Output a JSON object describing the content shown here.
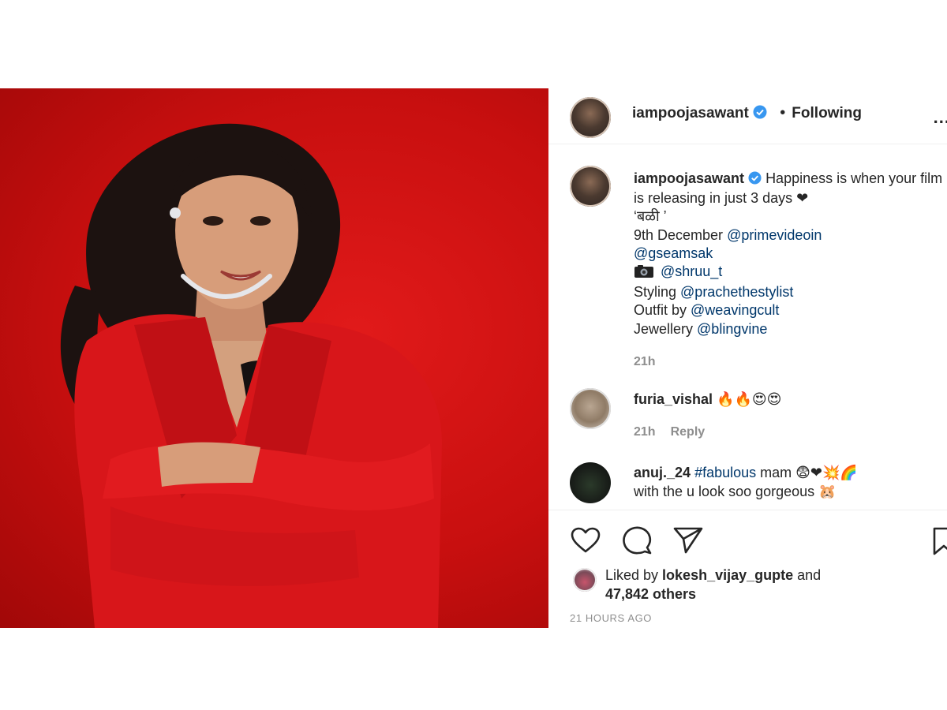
{
  "post": {
    "photo_alt": "",
    "header": {
      "username": "iampoojasawant",
      "separator": "•",
      "follow_status": "Following",
      "more_label": "..."
    },
    "caption": {
      "username": "iampoojasawant",
      "line1": "Happiness is when your film is releasing in just 3 days ❤",
      "line2": "‘बळी ’",
      "line3_prefix": "9th December ",
      "line3_mention": "@primevideoin",
      "line4_mention": "@gseamsak",
      "line5_icon": "camera-icon",
      "line5_mention": "@shruu_t",
      "line6_prefix": "Styling ",
      "line6_mention": "@prachethestylist",
      "line7_prefix": "Outfit by ",
      "line7_mention": "@weavingcult",
      "line8_prefix": "Jewellery ",
      "line8_mention": "@blingvine",
      "time": "21h"
    },
    "comments": [
      {
        "username": "furia_vishal",
        "text": "🔥🔥😍😍",
        "time": "21h",
        "reply_label": "Reply"
      },
      {
        "username": "anuj._24",
        "hashtag": "#fabulous",
        "text_after_tag": " mam 😨❤💥🌈",
        "line2": "with the u look soo gorgeous 🐹"
      }
    ],
    "likes": {
      "prefix": "Liked by ",
      "user": "lokesh_vijay_gupte",
      "middle": " and",
      "others": "47,842 others"
    },
    "timestamp": "21 HOURS AGO",
    "icons": {
      "like": "heart-icon",
      "comment": "comment-icon",
      "share": "share-icon",
      "save": "bookmark-icon",
      "verified": "verified-badge-icon"
    },
    "colors": {
      "verified": "#3897f0",
      "mention": "#00376b",
      "meta": "#8e8e8e",
      "photo_bg": "#d3100f"
    }
  }
}
